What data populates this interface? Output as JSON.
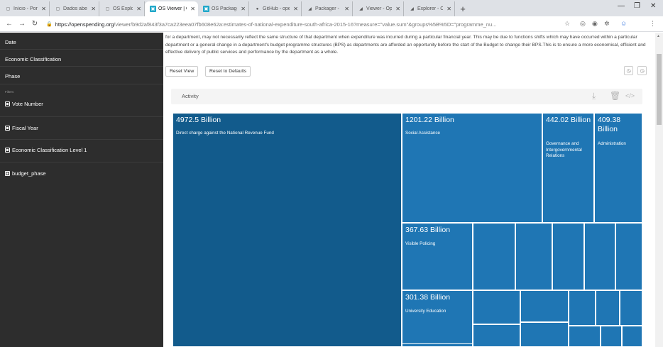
{
  "browser": {
    "tabs": [
      {
        "title": "Início - Portal d",
        "favicon": "page-icon",
        "active": false
      },
      {
        "title": "Dados abertos",
        "favicon": "page-icon",
        "active": false
      },
      {
        "title": "OS Explorer",
        "favicon": "page-icon",
        "active": false
      },
      {
        "title": "OS Viewer | Op",
        "favicon": "os-icon",
        "active": true
      },
      {
        "title": "OS Packager",
        "favicon": "os-icon",
        "active": false
      },
      {
        "title": "GitHub - open",
        "favicon": "github-icon",
        "active": false
      },
      {
        "title": "Packager - Ope",
        "favicon": "openspending-icon",
        "active": false
      },
      {
        "title": "Viewer - Open",
        "favicon": "openspending-icon",
        "active": false
      },
      {
        "title": "Explorer - Ope",
        "favicon": "openspending-icon",
        "active": false
      }
    ],
    "url_host": "https://openspending.org",
    "url_path": "/viewer/b9d2af843f3a7ca223eea07fb608e62a:estimates-of-national-expenditure-south-africa-2015-16?measure=\"value.sum\"&groups%5B%5D=\"programme_nu...",
    "toolbar_icons": [
      "back-icon",
      "forward-icon",
      "reload-icon",
      "lock-icon",
      "star-icon",
      "extension-icon",
      "profile-icon",
      "menu-icon"
    ]
  },
  "sidebar": {
    "items": [
      "Date",
      "Economic Classification",
      "Phase"
    ],
    "filters_label": "Filters",
    "filters": [
      "Vote Number",
      "Fiscal Year",
      "Economic Classification Level 1",
      "budget_phase"
    ]
  },
  "main": {
    "description": "for a department, may not necessarily reflect the same structure of that department when expenditure was incurred during a particular financial year. This may be due to functions shifts which may have occurred within a particular department or a general change in a department's budget programme structures (BPS) as departments are afforded an opportunity before the start of the Budget to change their BPS.This is to ensure a more economical, efficient and effective delivery of public services and performance by the department as a whole.",
    "reset_view": "Reset View",
    "reset_defaults": "Reset to Defaults",
    "activity": "Activity",
    "embed": "</>"
  },
  "colors": {
    "cell_primary": "#125b8c",
    "cell_secondary": "#1f76b4",
    "sidebar_bg": "#2d2d2d"
  },
  "treemap": {
    "cells": [
      {
        "value": "4972.5 Billion",
        "label": "Direct charge against the National Revenue Fund"
      },
      {
        "value": "1201.22 Billion",
        "label": "Social Assistance"
      },
      {
        "value": "442.02 Billion",
        "label": "Governance and Intergovernmental Relations"
      },
      {
        "value": "409.38 Billion",
        "label": "Administration"
      },
      {
        "value": "367.63 Billion",
        "label": "Visible Policing"
      },
      {
        "value": "301.38 Billion",
        "label": "University Education"
      }
    ]
  }
}
